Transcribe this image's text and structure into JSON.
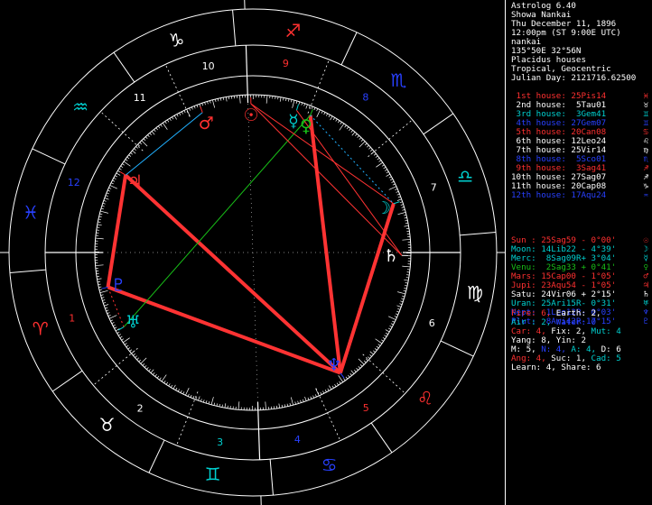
{
  "app": {
    "title": "Astrolog 6.40",
    "name": "Showa Nankai",
    "date": "Thu December 11, 1896",
    "time": "12:00pm (ST 9:00E UTC)",
    "place": "nankai",
    "coords": "135°50E 32°56N",
    "system": "Placidus houses",
    "zodiac": "Tropical, Geocentric",
    "julian": "Julian Day: 2121716.62500"
  },
  "colors": {
    "fire": "#ff3030",
    "earth": "#ffffff",
    "air": "#00d0d0",
    "water": "#2840ff",
    "wheel": "#ffffff",
    "aspect_red": "#ff3333",
    "aspect_green": "#18c018",
    "aspect_cyan": "#20b0ff"
  },
  "houses": [
    {
      "label": " 1st house:",
      "value": "25Pis14",
      "glyph": "♓",
      "color": "#ff3030"
    },
    {
      "label": " 2nd house:",
      "value": " 5Tau01",
      "glyph": "♉",
      "color": "#ffffff"
    },
    {
      "label": " 3rd house:",
      "value": " 3Gem41",
      "glyph": "♊",
      "color": "#00d0d0"
    },
    {
      "label": " 4th house:",
      "value": "27Gem07",
      "glyph": "♊",
      "color": "#2840ff"
    },
    {
      "label": " 5th house:",
      "value": "20Can08",
      "glyph": "♋",
      "color": "#ff3030"
    },
    {
      "label": " 6th house:",
      "value": "12Leo24",
      "glyph": "♌",
      "color": "#ffffff"
    },
    {
      "label": " 7th house:",
      "value": "25Vir14",
      "glyph": "♍",
      "color": "#ffffff"
    },
    {
      "label": " 8th house:",
      "value": " 5Sco01",
      "glyph": "♏",
      "color": "#2840ff"
    },
    {
      "label": " 9th house:",
      "value": " 3Sag41",
      "glyph": "♐",
      "color": "#ff3030"
    },
    {
      "label": "10th house:",
      "value": "27Sag07",
      "glyph": "♐",
      "color": "#ffffff"
    },
    {
      "label": "11th house:",
      "value": "20Cap08",
      "glyph": "♑",
      "color": "#ffffff"
    },
    {
      "label": "12th house:",
      "value": "17Aqu24",
      "glyph": "♒",
      "color": "#2840ff"
    }
  ],
  "planets": [
    {
      "label": "Sun :",
      "value": "25Sag59",
      "lat": " - 0°00'",
      "glyph": "☉",
      "color": "#ff3030"
    },
    {
      "label": "Moon:",
      "value": "14Lib22",
      "lat": " - 4°39'",
      "glyph": "☽",
      "color": "#00d0d0"
    },
    {
      "label": "Merc:",
      "value": " 8Sag09R",
      "lat": "+ 3°04'",
      "glyph": "☿",
      "color": "#00d0d0"
    },
    {
      "label": "Venu:",
      "value": " 2Sag33",
      "lat": " + 0°41'",
      "glyph": "♀",
      "color": "#18c018"
    },
    {
      "label": "Mars:",
      "value": "15Cap00",
      "lat": " - 1°05'",
      "glyph": "♂",
      "color": "#ff3030"
    },
    {
      "label": "Jupi:",
      "value": "23Aqu54",
      "lat": " - 1°05'",
      "glyph": "♃",
      "color": "#ff3030"
    },
    {
      "label": "Satu:",
      "value": "24Vir06",
      "lat": " + 2°15'",
      "glyph": "♄",
      "color": "#ffffff"
    },
    {
      "label": "Uran:",
      "value": "25Ari15R",
      "lat": "- 0°31'",
      "glyph": "♅",
      "color": "#00d0d0"
    },
    {
      "label": "Nept:",
      "value": " 1Leo12R",
      "lat": "- 0°03'",
      "glyph": "♆",
      "color": "#2840ff"
    },
    {
      "label": "Plut:",
      "value": " 8Ari42R",
      "lat": "-17°15'",
      "glyph": "♇",
      "color": "#2840ff"
    }
  ],
  "stats": [
    {
      "parts": [
        {
          "t": "Fire: 6, ",
          "c": "#ff3030"
        },
        {
          "t": "Earth: 2,",
          "c": "#ffffff"
        }
      ]
    },
    {
      "parts": [
        {
          "t": "Air : 2, ",
          "c": "#00d0d0"
        },
        {
          "t": "Water: 0",
          "c": "#2840ff"
        }
      ]
    },
    {
      "parts": [
        {
          "t": "Car: 4, ",
          "c": "#ff3030"
        },
        {
          "t": "Fix: 2, ",
          "c": "#ffffff"
        },
        {
          "t": "Mut: 4",
          "c": "#00d0d0"
        }
      ]
    },
    {
      "parts": [
        {
          "t": "Yang: 8, Yin: 2",
          "c": "#ffffff"
        }
      ]
    },
    {
      "parts": [
        {
          "t": "M: 5, ",
          "c": "#ffffff"
        },
        {
          "t": "N: 4, ",
          "c": "#2840ff"
        },
        {
          "t": "A: 4, ",
          "c": "#00d0d0"
        },
        {
          "t": "D: 6",
          "c": "#ffffff"
        }
      ]
    },
    {
      "parts": [
        {
          "t": "Ang: 4, ",
          "c": "#ff3030"
        },
        {
          "t": "Suc: 1, ",
          "c": "#ffffff"
        },
        {
          "t": "Cad: 5",
          "c": "#00d0d0"
        }
      ]
    },
    {
      "parts": [
        {
          "t": "Learn: 4, Share: 6",
          "c": "#ffffff"
        }
      ]
    }
  ],
  "wheel": {
    "asc_longitude": 355.23,
    "cusps": [
      355.23,
      35.02,
      63.68,
      87.12,
      110.13,
      132.4,
      175.23,
      215.02,
      243.68,
      267.12,
      290.13,
      312.4
    ],
    "house_numbers": [
      "1",
      "2",
      "3",
      "4",
      "5",
      "6",
      "7",
      "8",
      "9",
      "10",
      "11",
      "12"
    ],
    "sign_glyphs": [
      "♈",
      "♉",
      "♊",
      "♋",
      "♌",
      "♍",
      "♎",
      "♏",
      "♐",
      "♑",
      "♒",
      "♓"
    ],
    "sign_colors": [
      "#ff3030",
      "#ffffff",
      "#00d0d0",
      "#2840ff",
      "#ff3030",
      "#ffffff",
      "#00d0d0",
      "#2840ff",
      "#ff3030",
      "#ffffff",
      "#00d0d0",
      "#2840ff"
    ],
    "planet_longitudes": [
      265.98,
      194.37,
      248.15,
      242.55,
      285.0,
      323.9,
      174.1,
      25.25,
      121.2,
      8.7
    ],
    "aspects": [
      {
        "a": 5,
        "b": 8,
        "color": "#ff3333",
        "style": "thick"
      },
      {
        "a": 5,
        "b": 9,
        "color": "#ff3333",
        "style": "thick"
      },
      {
        "a": 8,
        "b": 9,
        "color": "#ff3333",
        "style": "thick"
      },
      {
        "a": 3,
        "b": 8,
        "color": "#ff3333",
        "style": "thick"
      },
      {
        "a": 1,
        "b": 8,
        "color": "#ff3333",
        "style": "thick"
      },
      {
        "a": 3,
        "b": 7,
        "color": "#18c018",
        "style": "thin"
      },
      {
        "a": 0,
        "b": 6,
        "color": "#ff3333",
        "style": "thin"
      },
      {
        "a": 2,
        "b": 6,
        "color": "#ff3333",
        "style": "thin"
      },
      {
        "a": 1,
        "b": 0,
        "color": "#ff3333",
        "style": "thin"
      },
      {
        "a": 7,
        "b": 9,
        "color": "#ff3333",
        "style": "dotted"
      },
      {
        "a": 3,
        "b": 1,
        "color": "#20b0ff",
        "style": "dotted"
      },
      {
        "a": 4,
        "b": 5,
        "color": "#20b0ff",
        "style": "thin"
      }
    ]
  }
}
